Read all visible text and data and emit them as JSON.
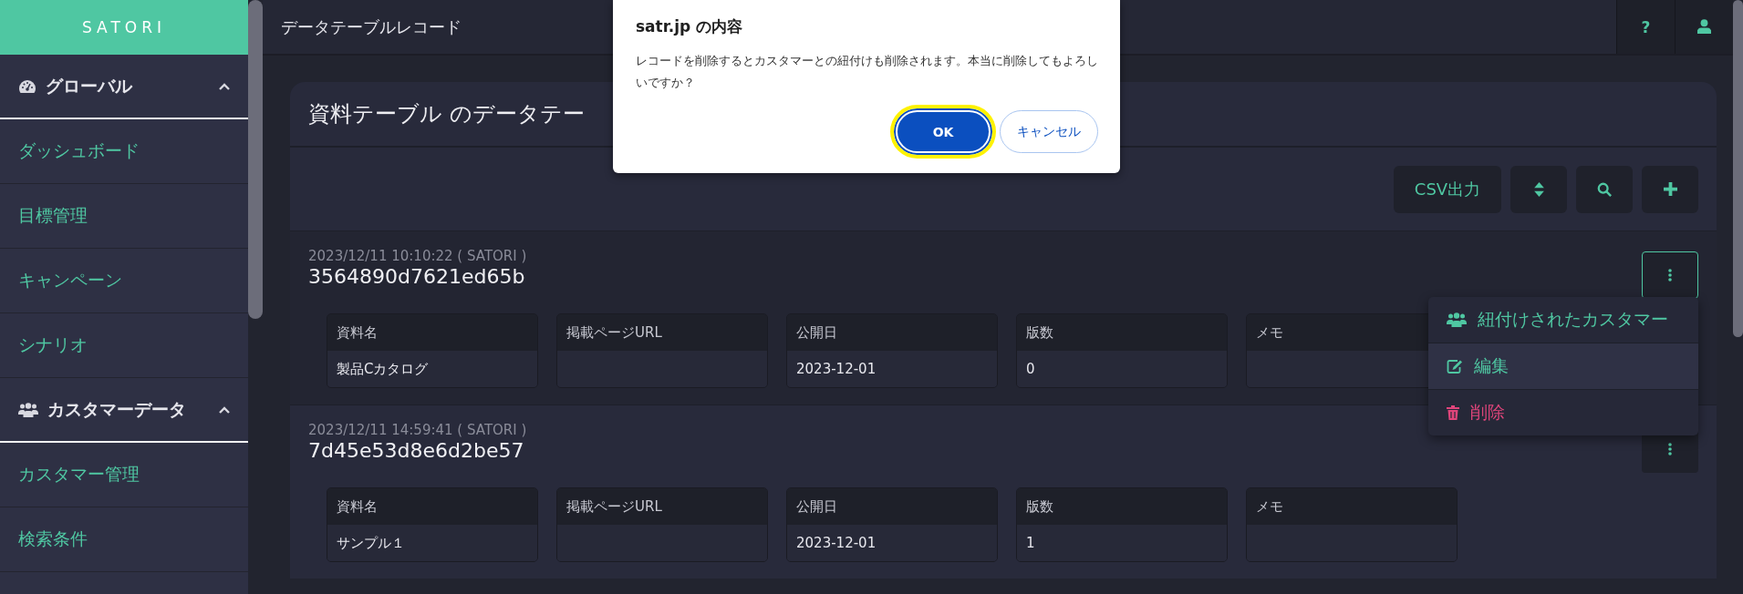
{
  "sidebar": {
    "logo": "SATORI",
    "groups": [
      {
        "kind": "dashboard",
        "label": "グローバル",
        "expanded": true,
        "items": [
          "ダッシュボード",
          "目標管理",
          "キャンペーン",
          "シナリオ"
        ]
      },
      {
        "kind": "customers",
        "label": "カスタマーデータ",
        "expanded": true,
        "items": [
          "カスタマー管理",
          "検索条件"
        ]
      }
    ]
  },
  "header": {
    "title": "データテーブルレコード",
    "help": "?"
  },
  "card": {
    "title": "資料テーブル のデータテー",
    "toolbar": [
      {
        "kind": "text",
        "label": "CSV出力"
      },
      {
        "kind": "sort"
      },
      {
        "kind": "search"
      },
      {
        "kind": "add"
      }
    ],
    "records": [
      {
        "meta": "2023/12/11 10:10:22 ( SATORI )",
        "id": "3564890d7621ed65b",
        "menu_open": true,
        "fields": [
          {
            "label": "資料名",
            "value": "製品Cカタログ"
          },
          {
            "label": "掲載ページURL"
          },
          {
            "label": "公開日",
            "value": "2023-12-01"
          },
          {
            "label": "版数",
            "value": "0"
          },
          {
            "label": "メモ"
          }
        ]
      },
      {
        "meta": "2023/12/11 14:59:41 ( SATORI )",
        "id": "7d45e53d8e6d2be57",
        "menu_open": false,
        "fields": [
          {
            "label": "資料名",
            "value": "サンプル１"
          },
          {
            "label": "掲載ページURL"
          },
          {
            "label": "公開日",
            "value": "2023-12-01"
          },
          {
            "label": "版数",
            "value": "1"
          },
          {
            "label": "メモ"
          }
        ]
      }
    ]
  },
  "menu": {
    "items": [
      {
        "kind": "customers",
        "label": "紐付けされたカスタマー",
        "selected": false
      },
      {
        "kind": "edit",
        "label": "編集",
        "selected": true
      },
      {
        "kind": "delete",
        "label": "削除",
        "selected": false
      }
    ]
  },
  "dialog": {
    "title": "satr.jp の内容",
    "message": "レコードを削除するとカスタマーとの紐付けも削除されます。本当に削除してもよろしいですか？",
    "buttons": [
      {
        "kind": "primary",
        "label": "OK",
        "focused": true
      },
      {
        "kind": "secondary",
        "label": "キャンセル",
        "focused": false
      }
    ]
  }
}
